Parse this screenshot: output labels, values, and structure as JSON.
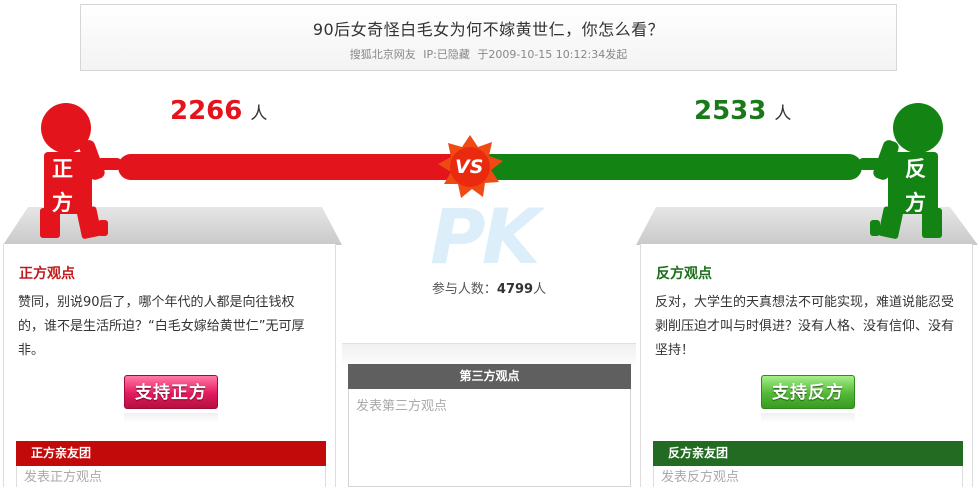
{
  "header": {
    "title": "90后女奇怪白毛女为何不嫁黄世仁，你怎么看？",
    "author": "搜狐北京网友",
    "ip": "IP:已隐藏",
    "time": "于2009-10-15 10:12:34发起"
  },
  "pro": {
    "count": "2266",
    "unit": "人",
    "figure_label_top": "正",
    "figure_label_bottom": "方",
    "heading": "正方观点",
    "text": "赞同，别说90后了，哪个年代的人都是向往钱权的，谁不是生活所迫？“白毛女嫁给黄世仁”无可厚非。",
    "button": "支持正方",
    "club": "正方亲友团",
    "input_placeholder": "发表正方观点",
    "color": "#e3141c"
  },
  "con": {
    "count": "2533",
    "unit": "人",
    "figure_label_top": "反",
    "figure_label_bottom": "方",
    "heading": "反方观点",
    "text": "反对，大学生的天真想法不可能实现，难道说能忍受剥削压迫才叫与时俱进？没有人格、没有信仰、没有坚持！",
    "button": "支持反方",
    "club": "反方亲友团",
    "input_placeholder": "发表反方观点",
    "color": "#1a7a1a"
  },
  "center": {
    "vs": "VS",
    "watermark": "PK",
    "participants_label": "参与人数：",
    "participants_count": "4799",
    "participants_unit": "人",
    "third_heading": "第三方观点",
    "third_placeholder": "发表第三方观点"
  }
}
